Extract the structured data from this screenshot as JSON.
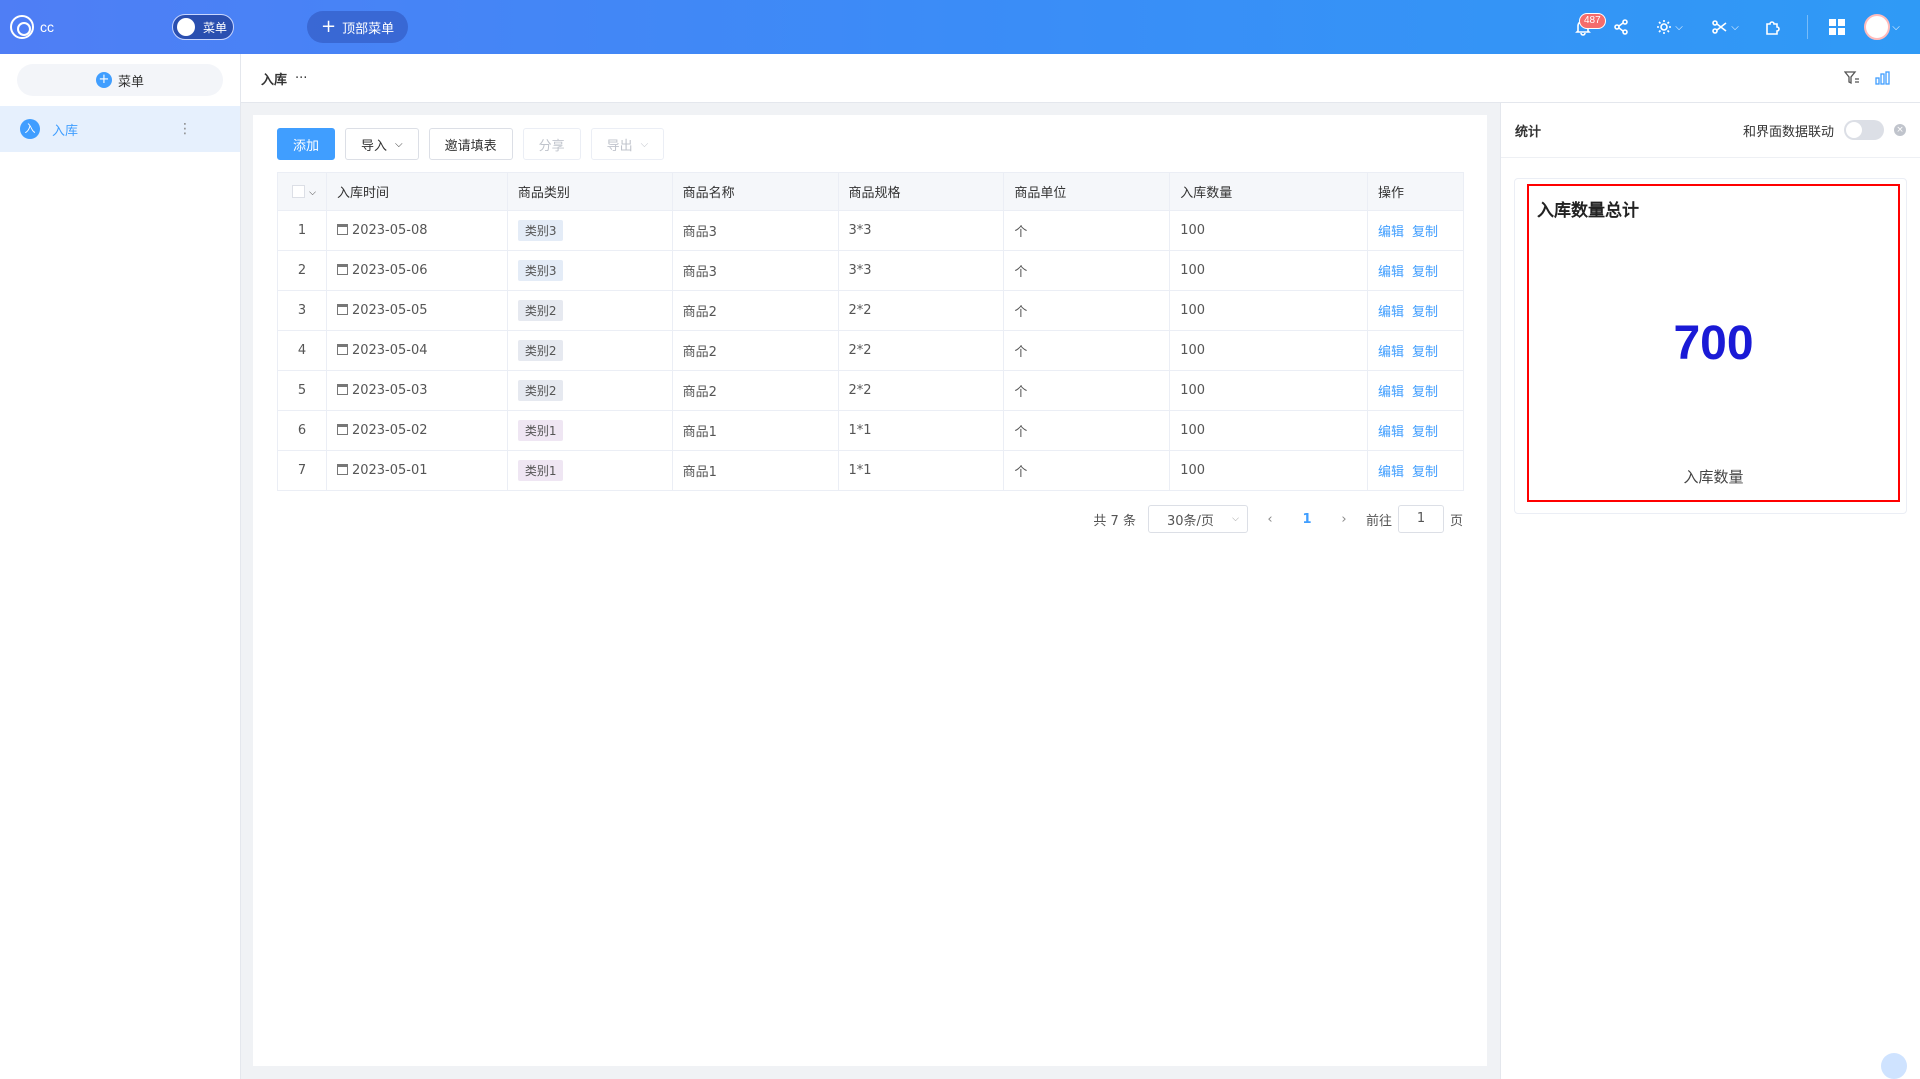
{
  "app": {
    "title": "cc",
    "menu_toggle_label": "菜单",
    "top_menu_label": "顶部菜单",
    "notification_count": "487"
  },
  "sidebar": {
    "add_label": "菜单",
    "items": [
      {
        "icon_text": "入",
        "label": "入库"
      }
    ]
  },
  "page": {
    "title": "入库",
    "dots": "···"
  },
  "toolbar": {
    "add": "添加",
    "import": "导入",
    "invite": "邀请填表",
    "share": "分享",
    "export": "导出"
  },
  "table": {
    "headers": [
      "入库时间",
      "商品类别",
      "商品名称",
      "商品规格",
      "商品单位",
      "入库数量",
      "操作"
    ],
    "rows": [
      {
        "idx": "1",
        "date": "2023-05-08",
        "category": "类别3",
        "name": "商品3",
        "spec": "3*3",
        "unit": "个",
        "qty": "100"
      },
      {
        "idx": "2",
        "date": "2023-05-06",
        "category": "类别3",
        "name": "商品3",
        "spec": "3*3",
        "unit": "个",
        "qty": "100"
      },
      {
        "idx": "3",
        "date": "2023-05-05",
        "category": "类别2",
        "name": "商品2",
        "spec": "2*2",
        "unit": "个",
        "qty": "100"
      },
      {
        "idx": "4",
        "date": "2023-05-04",
        "category": "类别2",
        "name": "商品2",
        "spec": "2*2",
        "unit": "个",
        "qty": "100"
      },
      {
        "idx": "5",
        "date": "2023-05-03",
        "category": "类别2",
        "name": "商品2",
        "spec": "2*2",
        "unit": "个",
        "qty": "100"
      },
      {
        "idx": "6",
        "date": "2023-05-02",
        "category": "类别1",
        "name": "商品1",
        "spec": "1*1",
        "unit": "个",
        "qty": "100"
      },
      {
        "idx": "7",
        "date": "2023-05-01",
        "category": "类别1",
        "name": "商品1",
        "spec": "1*1",
        "unit": "个",
        "qty": "100"
      }
    ],
    "actions": {
      "edit": "编辑",
      "copy": "复制"
    }
  },
  "pager": {
    "total": "共 7 条",
    "page_size": "30条/页",
    "current": "1",
    "goto_prefix": "前往",
    "goto_value": "1",
    "goto_suffix": "页"
  },
  "stats": {
    "title": "统计",
    "link_label": "和界面数据联动",
    "card_title": "入库数量总计",
    "value": "700",
    "label": "入库数量"
  },
  "colors": {
    "accent": "#409eff",
    "stat_value": "#1a1ad6",
    "highlight_border": "#ff0000"
  }
}
